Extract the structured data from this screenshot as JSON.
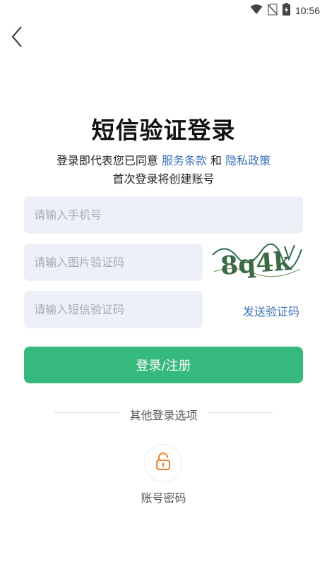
{
  "status_bar": {
    "time": "10:56",
    "icons": [
      "wifi-icon",
      "no-sim-icon",
      "battery-charging-icon"
    ]
  },
  "nav": {
    "back_icon": "chevron-left-icon"
  },
  "title": "短信验证登录",
  "agreement": {
    "prefix": "登录即代表您已同意",
    "terms_link": "服务条款",
    "conjunction": "和",
    "privacy_link": "隐私政策"
  },
  "create_note": "首次登录将创建账号",
  "form": {
    "phone_placeholder": "请输入手机号",
    "image_code_placeholder": "请输入图片验证码",
    "captcha_text": "8q4k",
    "sms_code_placeholder": "请输入短信验证码",
    "send_code_label": "发送验证码",
    "submit_label": "登录/注册"
  },
  "other_options": {
    "label": "其他登录选项",
    "password_login": {
      "icon": "lock-icon",
      "label": "账号密码"
    }
  },
  "colors": {
    "accent_green": "#35b97c",
    "link_blue": "#3f73b8",
    "field_bg": "#eef0f7",
    "lock_orange": "#f08b3a"
  }
}
